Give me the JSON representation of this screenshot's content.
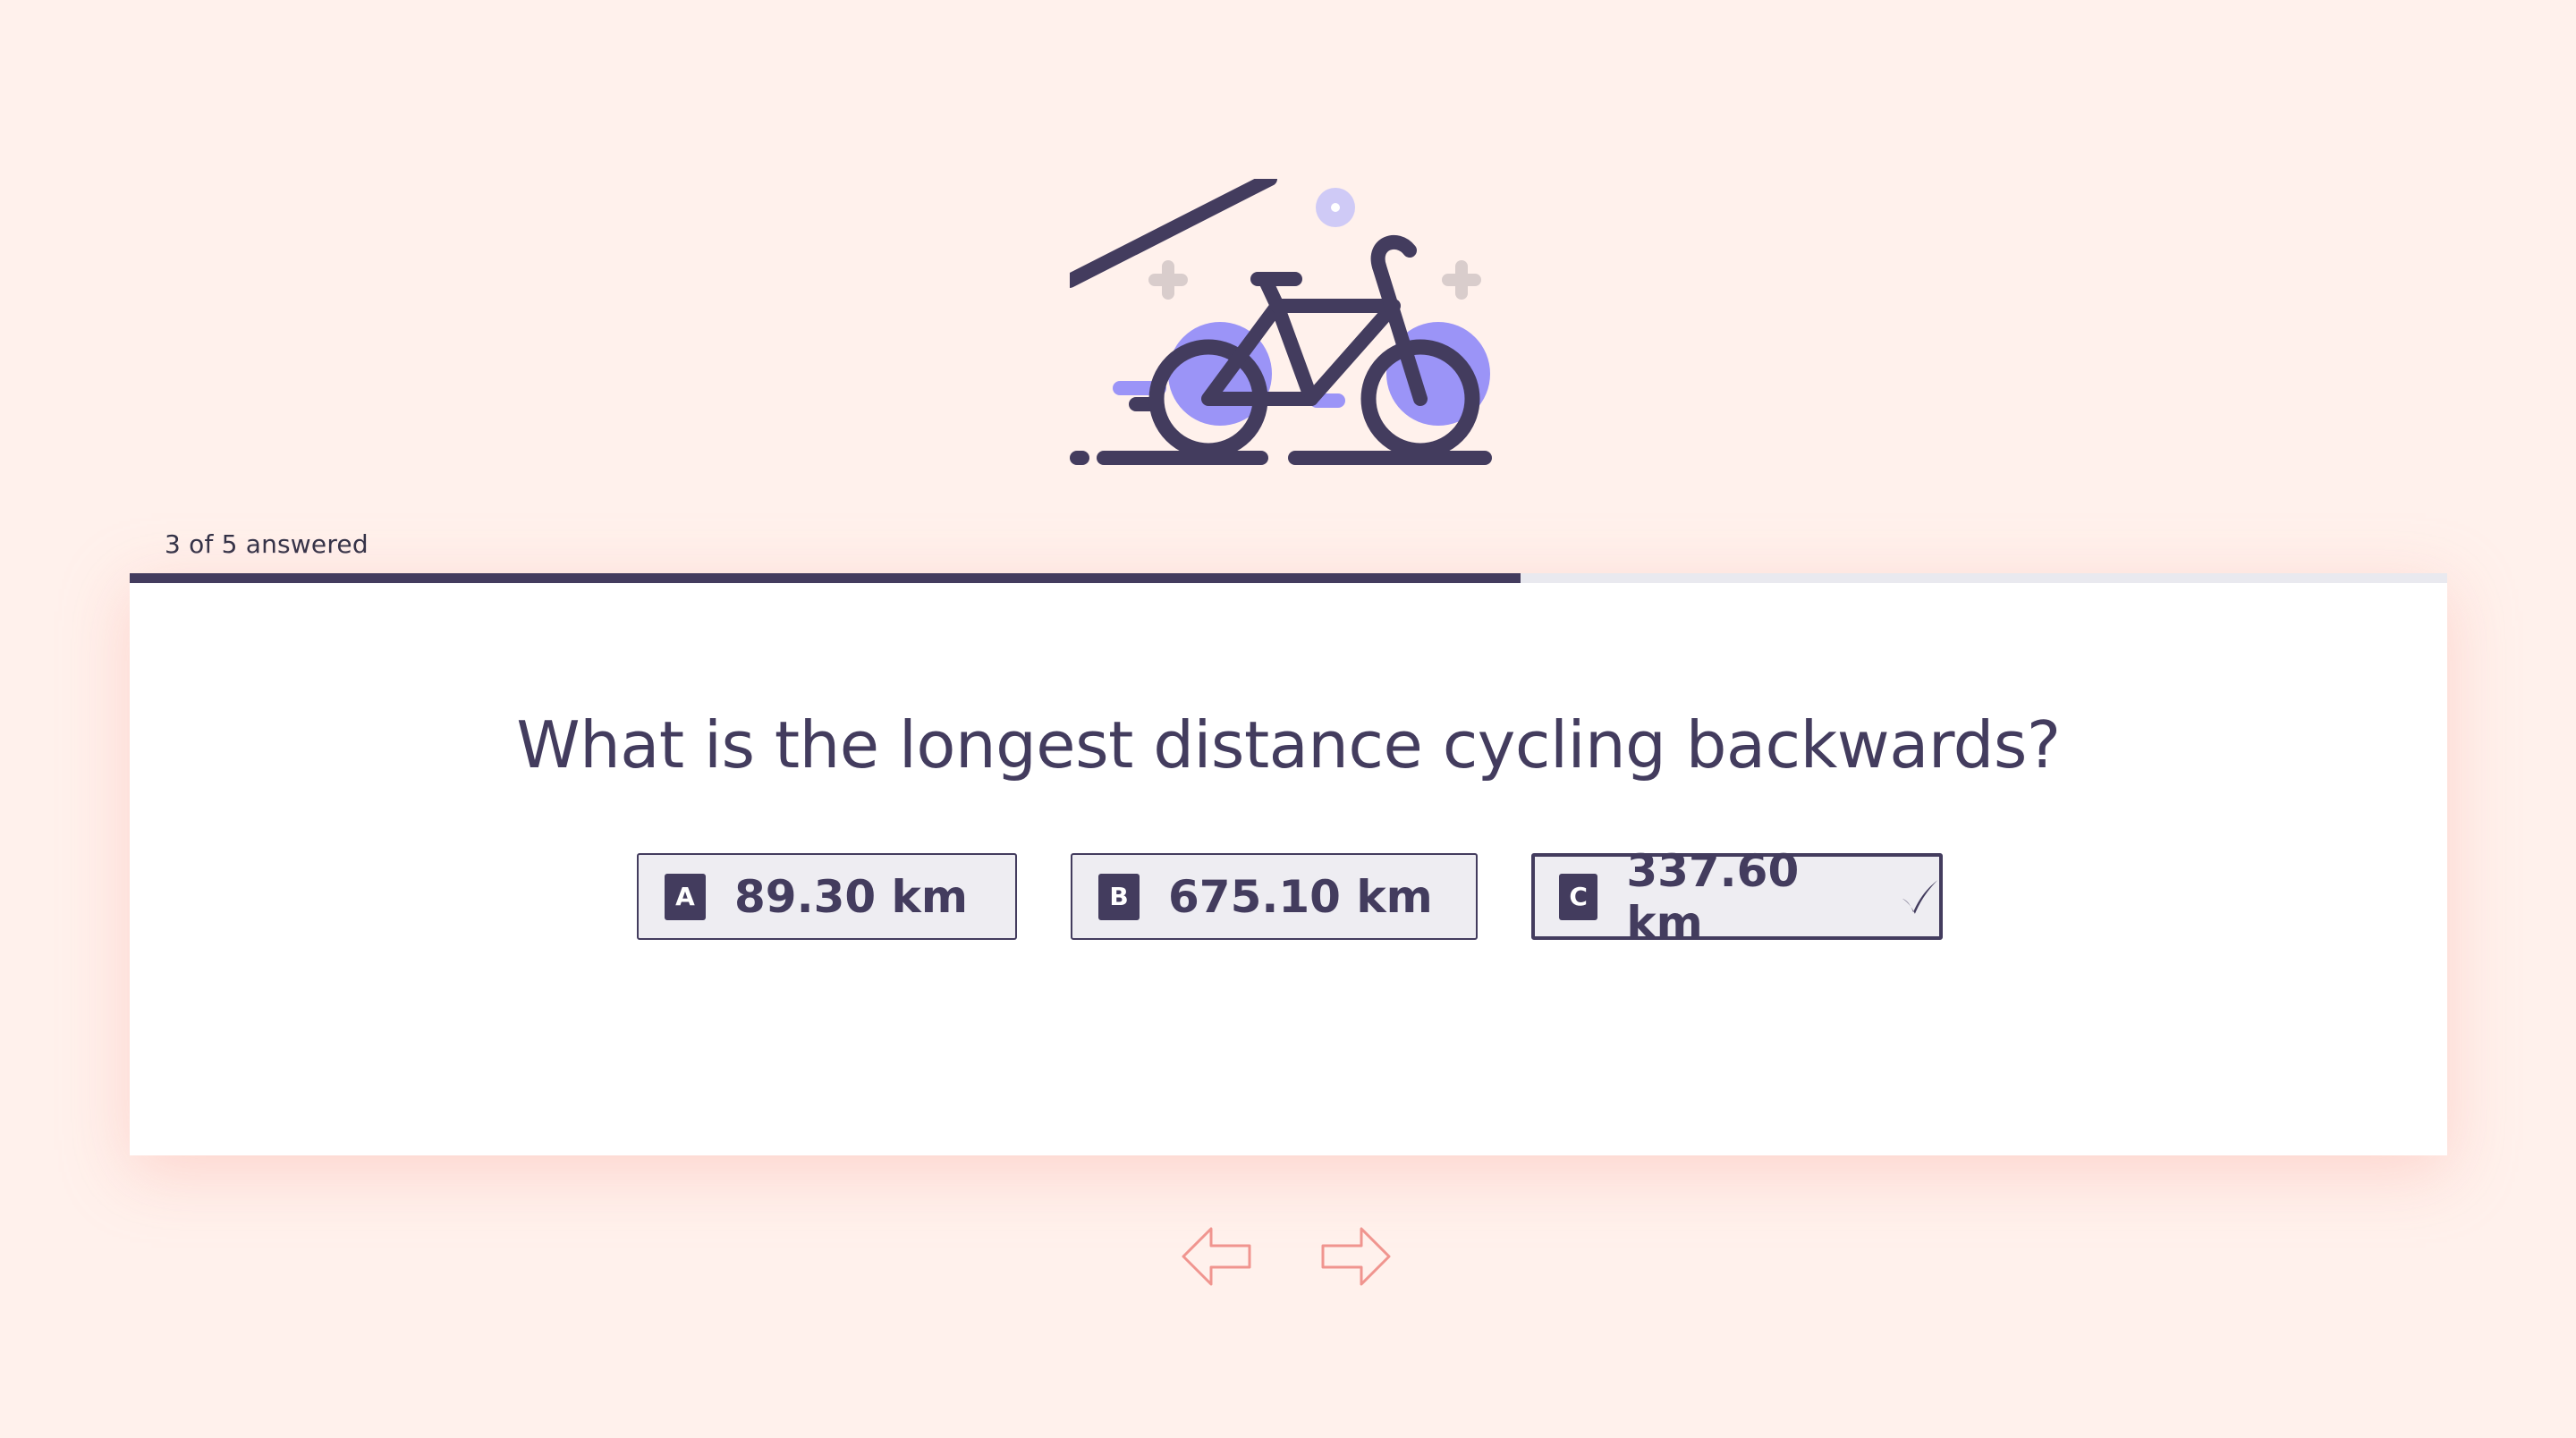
{
  "progress": {
    "label": "3 of 5 answered",
    "answered": 3,
    "total": 5,
    "fraction": 0.6
  },
  "hero": {
    "icon": "bicycle-icon"
  },
  "question": {
    "text": "What is the longest distance cycling backwards?",
    "options": [
      {
        "letter": "A",
        "text": "89.30 km",
        "selected": false
      },
      {
        "letter": "B",
        "text": "675.10 km",
        "selected": false
      },
      {
        "letter": "C",
        "text": "337.60 km",
        "selected": true
      }
    ]
  },
  "navigation": {
    "prev_icon": "arrow-left-icon",
    "next_icon": "arrow-right-icon"
  },
  "colors": {
    "background": "#fff1ec",
    "primary": "#433c5e",
    "accent_wheel": "#9b94f7",
    "nav_arrow": "#f0958f",
    "card": "#ffffff"
  }
}
